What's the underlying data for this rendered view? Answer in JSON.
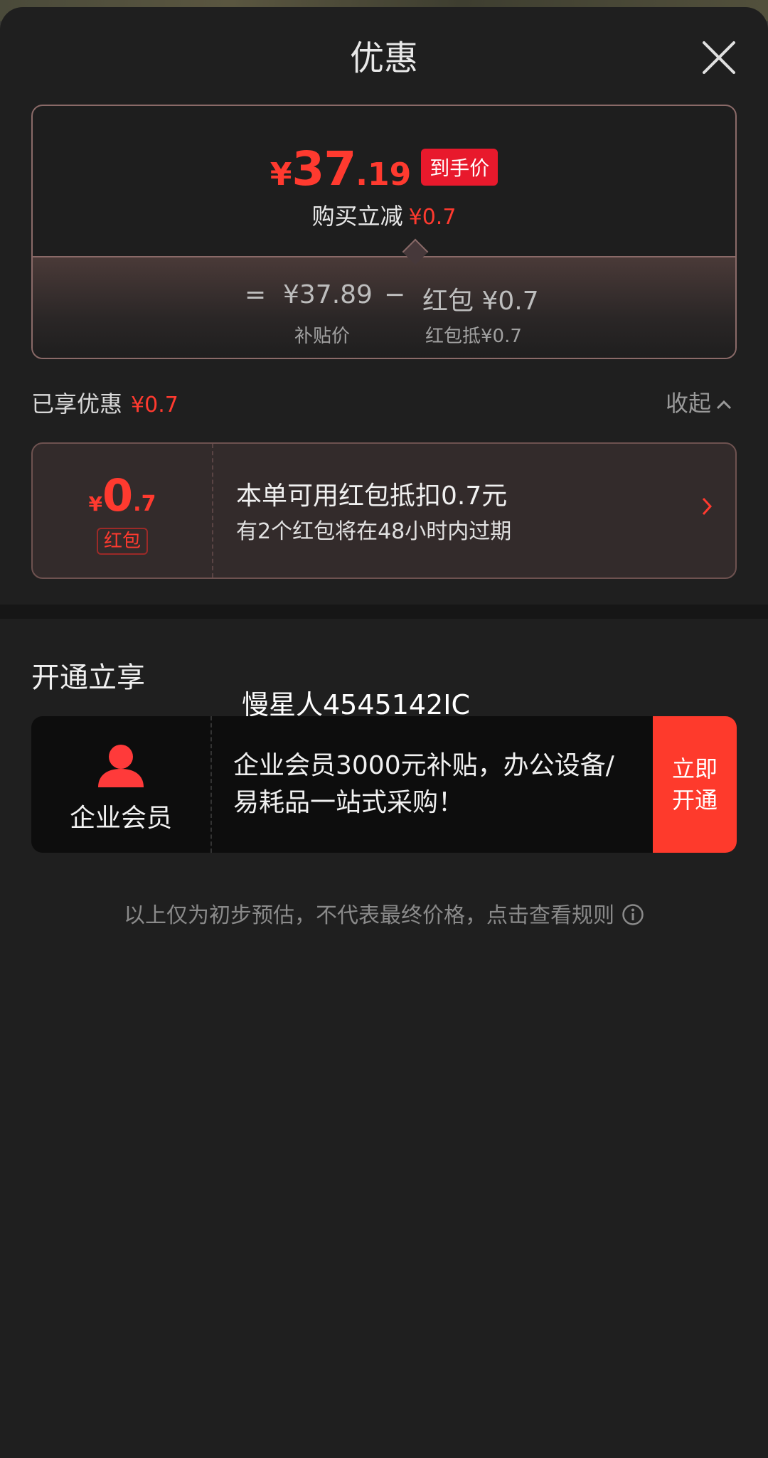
{
  "header": {
    "title": "优惠"
  },
  "price_card": {
    "currency": "¥",
    "final_integer": "37",
    "final_decimal": ".19",
    "final_badge": "到手价",
    "reduce_label": "购买立减",
    "reduce_amount": "¥0.7",
    "equals": "=",
    "subsidy_price": "¥37.89",
    "minus": "−",
    "packet_label": "红包 ¥0.7",
    "subsidy_caption": "补贴价",
    "packet_caption": "红包抵¥0.7"
  },
  "enjoyed": {
    "label": "已享优惠",
    "amount": "¥0.7",
    "collapse_label": "收起"
  },
  "red_packet": {
    "currency": "¥",
    "integer": "0",
    "decimal": ".7",
    "tag": "红包",
    "title": "本单可用红包抵扣0.7元",
    "subtitle": "有2个红包将在48小时内过期"
  },
  "open_section": {
    "title": "开通立享",
    "watermark": "慢星人4545142IC",
    "member_name": "企业会员",
    "member_desc": " 企业会员3000元补贴，办公设备/易耗品一站式采购！",
    "button_line1": "立即",
    "button_line2": "开通"
  },
  "disclaimer": "以上仅为初步预估，不代表最终价格，点击查看规则",
  "colors": {
    "accent": "#ff3a2f",
    "badge": "#e8192c",
    "button": "#fe3a2c",
    "background": "#1f1f1f"
  }
}
